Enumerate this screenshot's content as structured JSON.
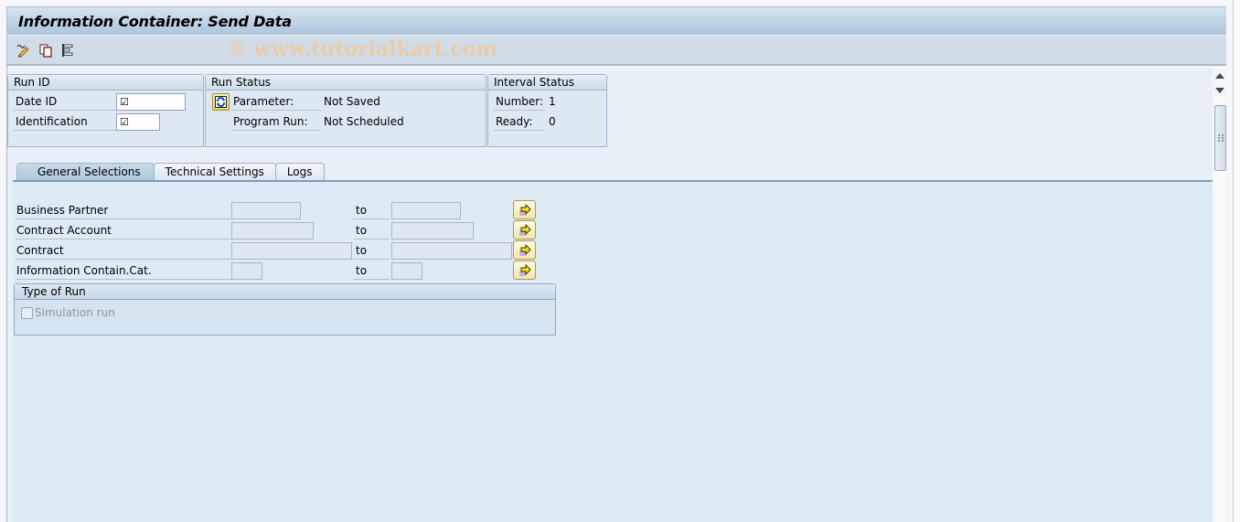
{
  "window": {
    "title": "Information Container: Send Data"
  },
  "toolbar": {
    "icons": [
      {
        "name": "edit-variant-icon",
        "tooltip": "Edit"
      },
      {
        "name": "copy-icon",
        "tooltip": "Copy"
      },
      {
        "name": "list-icon",
        "tooltip": "Log"
      }
    ],
    "watermark": "© www.tutorialkart.com"
  },
  "run_id": {
    "title": "Run ID",
    "fields": [
      {
        "label": "Date ID",
        "value": "☑"
      },
      {
        "label": "Identification",
        "value": "☑"
      }
    ]
  },
  "run_status": {
    "title": "Run Status",
    "rows": [
      {
        "label": "Parameter:",
        "value": "Not Saved"
      },
      {
        "label": "Program Run:",
        "value": "Not Scheduled"
      }
    ]
  },
  "interval_status": {
    "title": "Interval Status",
    "rows": [
      {
        "label": "Number:",
        "value": "1"
      },
      {
        "label": "Ready:",
        "value": "0"
      }
    ]
  },
  "tabs": [
    {
      "label": "General Selections",
      "active": true
    },
    {
      "label": "Technical Settings",
      "active": false
    },
    {
      "label": "Logs",
      "active": false
    }
  ],
  "selections": [
    {
      "label": "Business Partner",
      "from": "",
      "to_label": "to",
      "to": ""
    },
    {
      "label": "Contract Account",
      "from": "",
      "to_label": "to",
      "to": ""
    },
    {
      "label": "Contract",
      "from": "",
      "to_label": "to",
      "to": ""
    },
    {
      "label": "Information Contain.Cat.",
      "from": "",
      "to_label": "to",
      "to": ""
    }
  ],
  "type_of_run": {
    "title": "Type of Run",
    "simulation_label": "Simulation run",
    "simulation_checked": false
  }
}
